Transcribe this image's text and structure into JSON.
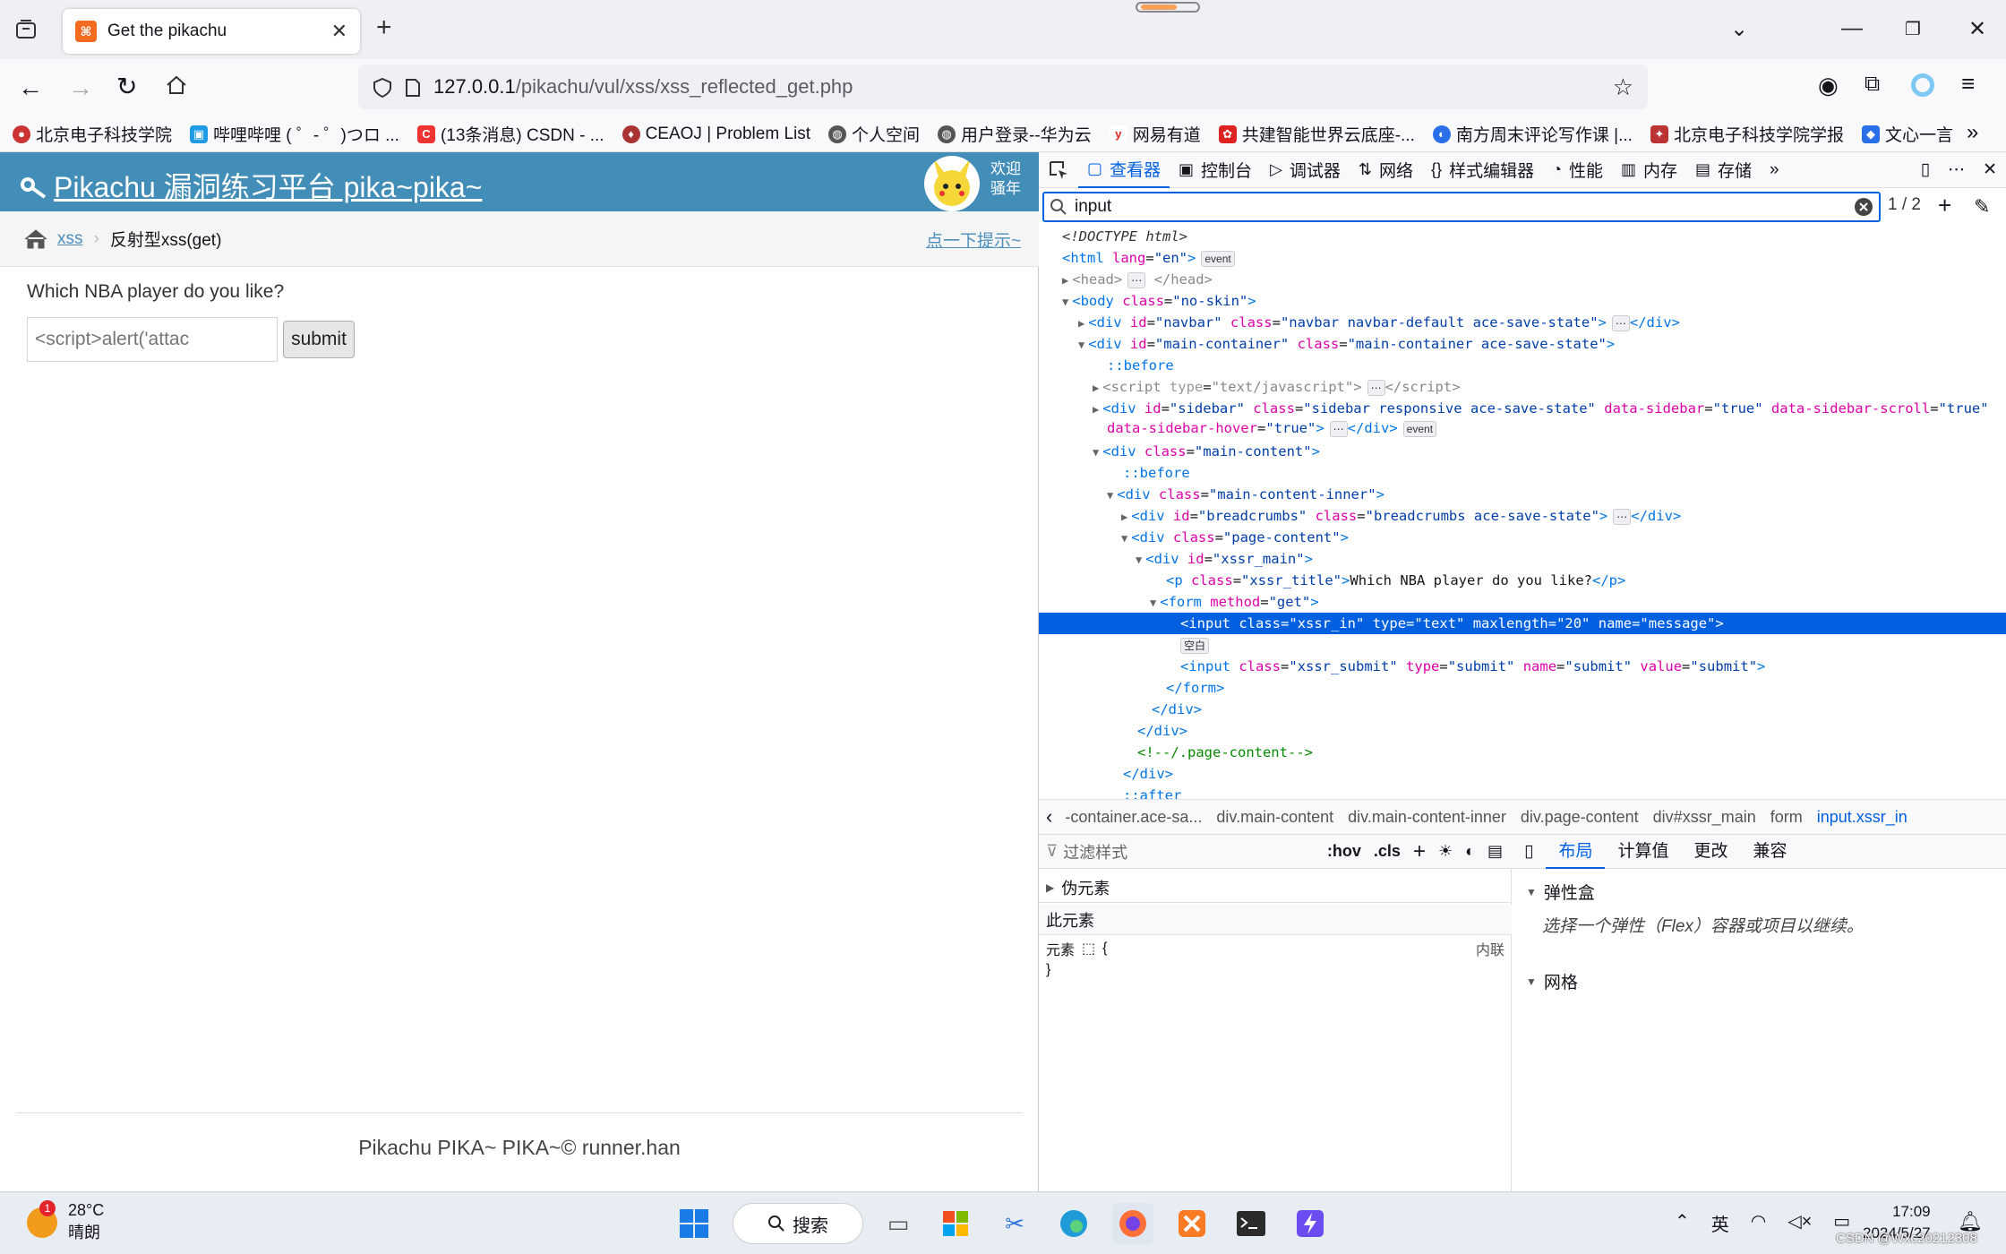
{
  "browser": {
    "tab_title": "Get the pikachu",
    "url_host": "127.0.0.1",
    "url_path": "/pikachu/vul/xss/xss_reflected_get.php",
    "bookmarks": [
      "北京电子科技学院",
      "哔哩哔哩 ( ゜- ゜)つロ ...",
      "(13条消息) CSDN - ...",
      "CEAOJ | Problem List",
      "个人空间",
      "用户登录--华为云",
      "网易有道",
      "共建智能世界云底座-...",
      "南方周末评论写作课 |...",
      "北京电子科技学院学报",
      "文心一言"
    ]
  },
  "page": {
    "title": "Pikachu 漏洞练习平台 pika~pika~",
    "welcome_line1": "欢迎",
    "welcome_line2": "骚年",
    "breadcrumb_link": "xss",
    "breadcrumb_current": "反射型xss(get)",
    "hint": "点一下提示~",
    "question": "Which NBA player do you like?",
    "input_value": "<script>alert('attac",
    "submit_label": "submit",
    "footer": "Pikachu PIKA~ PIKA~© runner.han"
  },
  "devtools": {
    "tabs": [
      "查看器",
      "控制台",
      "调试器",
      "网络",
      "样式编辑器",
      "性能",
      "内存",
      "存储"
    ],
    "search_value": "input",
    "search_count": "1 / 2",
    "breadcrumbs": [
      "-container.ace-sa...",
      "div.main-content",
      "div.main-content-inner",
      "div.page-content",
      "div#xssr_main",
      "form",
      "input.xssr_in"
    ],
    "filter_placeholder": "过滤样式",
    "hov": ":hov",
    "cls": ".cls",
    "pseudo": "伪元素",
    "this_element": "此元素",
    "element_rule": "元素",
    "inline": "内联",
    "layout_tabs": [
      "布局",
      "计算值",
      "更改",
      "兼容"
    ],
    "flexbox_title": "弹性盒",
    "flexbox_hint": "选择一个弹性（Flex）容器或项目以继续。",
    "grid_title": "网格"
  },
  "taskbar": {
    "temp": "28°C",
    "weather": "晴朗",
    "badge": "1",
    "search": "搜索",
    "ime": "英",
    "time": "17:09",
    "date": "2024/5/27",
    "watermark": "CSDN @Wxc20212308"
  }
}
